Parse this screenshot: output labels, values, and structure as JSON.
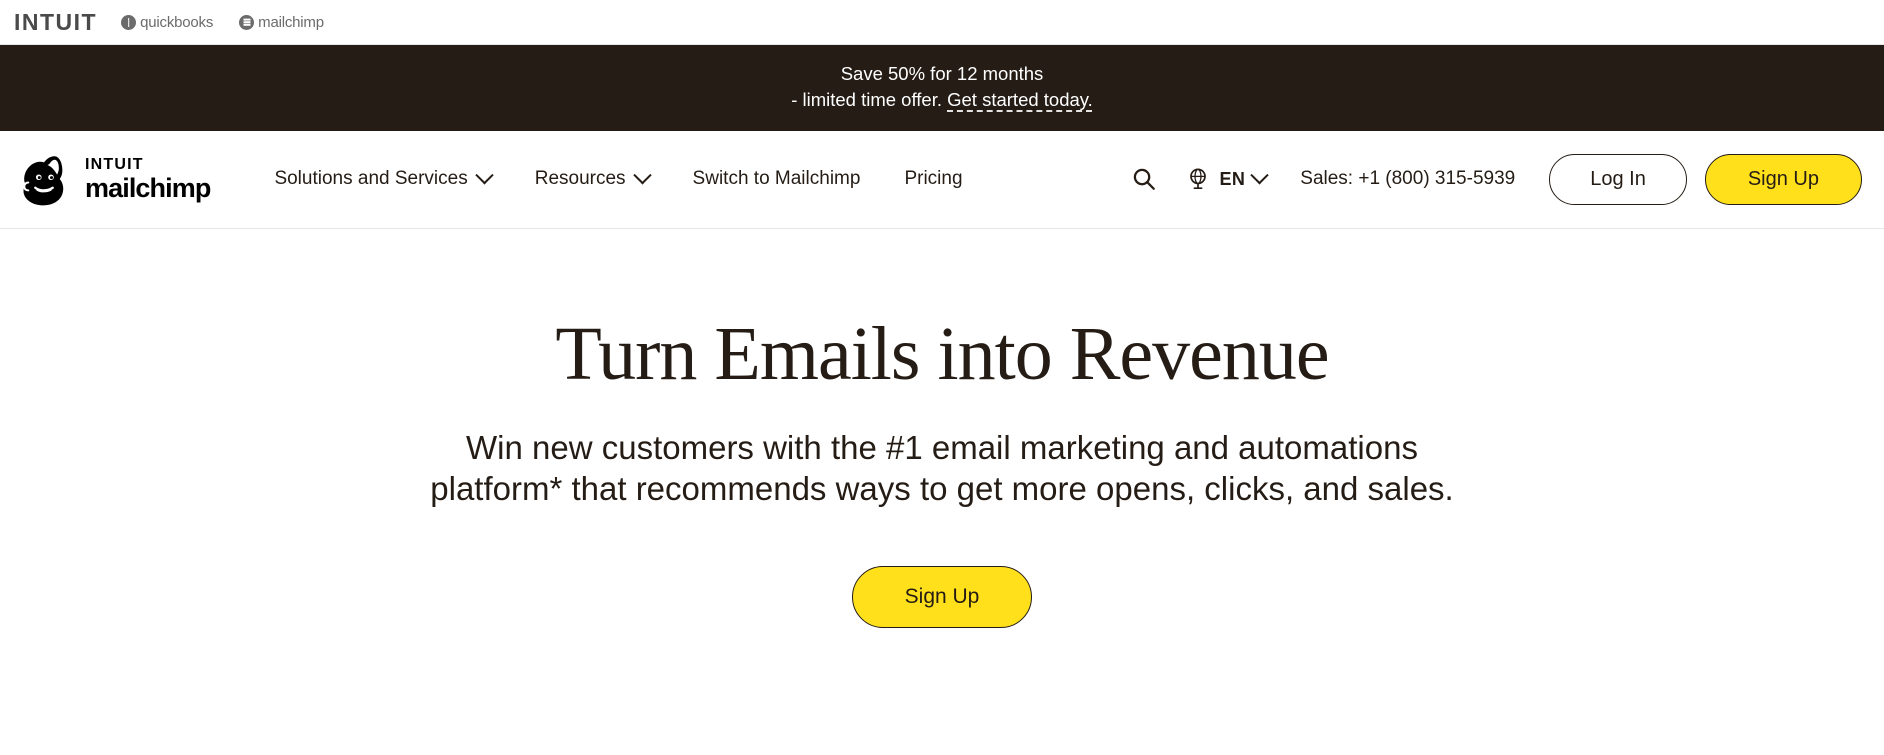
{
  "intuit_bar": {
    "logo": "INTUIT",
    "products": [
      {
        "label": "quickbooks",
        "icon": "quickbooks-icon"
      },
      {
        "label": "mailchimp",
        "icon": "mailchimp-icon"
      }
    ]
  },
  "promo": {
    "line1": "Save 50% for 12 months",
    "line2_prefix": "- limited time offer. ",
    "link": "Get started today.",
    "background": "#241C15",
    "text_color": "#FFFFFF"
  },
  "nav": {
    "brand": {
      "intuit": "INTUIT",
      "mailchimp": "mailchimp",
      "mascot": "freddie-monkey-icon"
    },
    "links": [
      {
        "label": "Solutions and Services",
        "has_dropdown": true
      },
      {
        "label": "Resources",
        "has_dropdown": true
      },
      {
        "label": "Switch to Mailchimp",
        "has_dropdown": false
      },
      {
        "label": "Pricing",
        "has_dropdown": false
      }
    ],
    "search_icon": "search-icon",
    "language": {
      "code": "EN",
      "icon": "globe-icon",
      "has_dropdown": true
    },
    "sales": "Sales: +1 (800) 315-5939",
    "login_label": "Log In",
    "signup_label": "Sign Up"
  },
  "hero": {
    "title": "Turn Emails into Revenue",
    "subtitle": "Win new customers with the #1 email marketing and automations platform* that recommends ways to get more opens, clicks, and sales.",
    "cta_label": "Sign Up"
  },
  "colors": {
    "brand_yellow": "#FFE01B",
    "ink": "#241C15",
    "page_background": "#FFFFFF"
  }
}
